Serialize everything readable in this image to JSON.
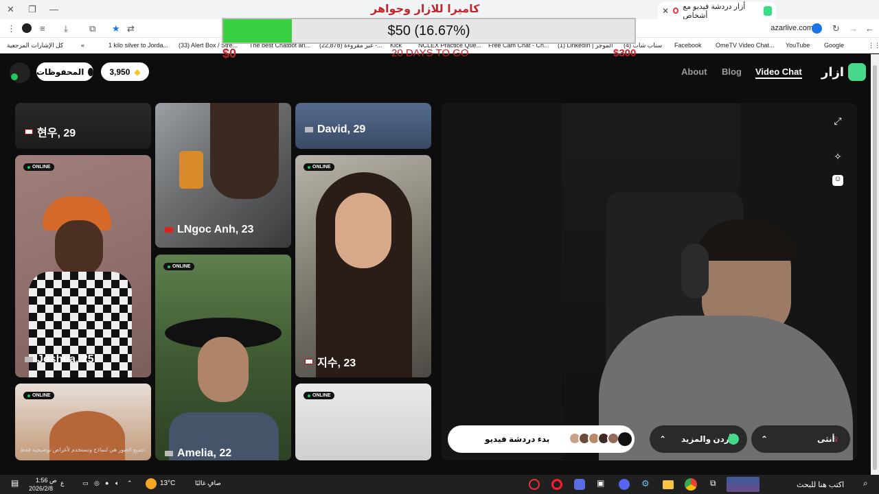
{
  "browser": {
    "tab_title": "أزار دردشة فيديو مع أشخاص",
    "url": "azarlive.com",
    "bookmarks": [
      "Google",
      "YouTube",
      "OmeTV Video Chat...",
      "Facebook",
      "(4) سناب شات",
      "(1) LinkedIn | الموجز",
      "Free Cam Chat - Ch...",
      "NCLEX Practice Que...",
      "Kick",
      "(22,878) غير مقروءة -...",
      "The best Chatbot an...",
      "(33) Alert Box / Stre...",
      "1 kilo silver to Jorda...",
      "كل الإشارات المرجعية"
    ]
  },
  "overlay": {
    "title": "كاميرا للازار وجواهر",
    "goal_text": "$50 (16.67%)",
    "goal_progress": 0.1667,
    "min_label": "$0",
    "days_label": "20 DAYS TO GO",
    "max_label": "$300"
  },
  "site": {
    "brand": "ازار",
    "nav": {
      "video_chat": "Video Chat",
      "blog": "Blog",
      "about": "About"
    },
    "gems": "3,950",
    "saved": "المحفوظات"
  },
  "cards": {
    "c1": "현우, 29",
    "c2": "David, 29",
    "c3": "LNgoc Anh, 23",
    "c4": "Joshua, 25",
    "c5": "지수, 23",
    "c6": "Amelia, 22",
    "online": "ONLINE",
    "disclaimer": "جميع الصور هي لنماذج وتستخدم لأغراض توضيحية فقط."
  },
  "video": {
    "start_label": "بدء دردشة فيديو",
    "region_label": "الأردن والمزيد",
    "gender_label": "أنثى"
  },
  "taskbar": {
    "search_placeholder": "اكتب هنا للبحث",
    "weather": "صافٍ غالبًا",
    "temperature": "13°C",
    "time": "1:56 ص",
    "date": "2026/2/8",
    "lang": "ع"
  },
  "colors": {
    "accent_green": "#47d88a",
    "online_green": "#22c55e",
    "overlay_red": "#c0272d",
    "goal_fill": "#39d141"
  }
}
